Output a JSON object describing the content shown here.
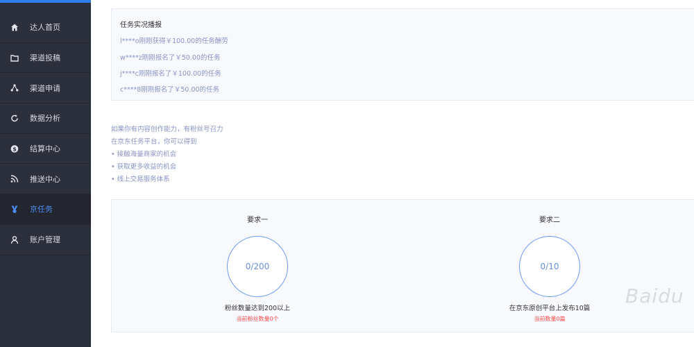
{
  "sidebar": {
    "items": [
      {
        "label": "达人首页",
        "icon": "home-icon"
      },
      {
        "label": "渠道投稿",
        "icon": "folder-icon"
      },
      {
        "label": "渠道申请",
        "icon": "share-icon"
      },
      {
        "label": "数据分析",
        "icon": "refresh-icon"
      },
      {
        "label": "结算中心",
        "icon": "dollar-icon"
      },
      {
        "label": "推送中心",
        "icon": "rss-icon"
      },
      {
        "label": "京任务",
        "icon": "medal-icon"
      },
      {
        "label": "账户管理",
        "icon": "user-icon"
      }
    ],
    "active_index": 6
  },
  "report": {
    "title": "任务实况播报",
    "lines": [
      "l****o刚刚获得￥100.00的任务酬劳",
      "w****z刚刚报名了￥50.00的任务",
      "j****c刚刚报名了￥100.00的任务",
      "c****8刚刚报名了￥50.00的任务"
    ]
  },
  "intro": {
    "line1": "如果你有内容创作能力，有粉丝号召力",
    "line2": "在京东任务平台，你可以得到",
    "bullets": [
      "• 接触海量商家的机会",
      "• 获取更多收益的机会",
      "• 线上交易服务体系"
    ]
  },
  "requirements": [
    {
      "title": "要求一",
      "progress": "0/200",
      "description": "粉丝数量达到200以上",
      "status": "当前粉丝数量0个"
    },
    {
      "title": "要求二",
      "progress": "0/10",
      "description": "在京东原创平台上发布10篇",
      "status": "当前数量0篇"
    }
  ],
  "watermark": "Baidu",
  "colors": {
    "sidebar_bg": "#2c2f3c",
    "accent": "#4b8cf5",
    "muted_text": "#8a93c2",
    "status_red": "#ff4a4a"
  }
}
